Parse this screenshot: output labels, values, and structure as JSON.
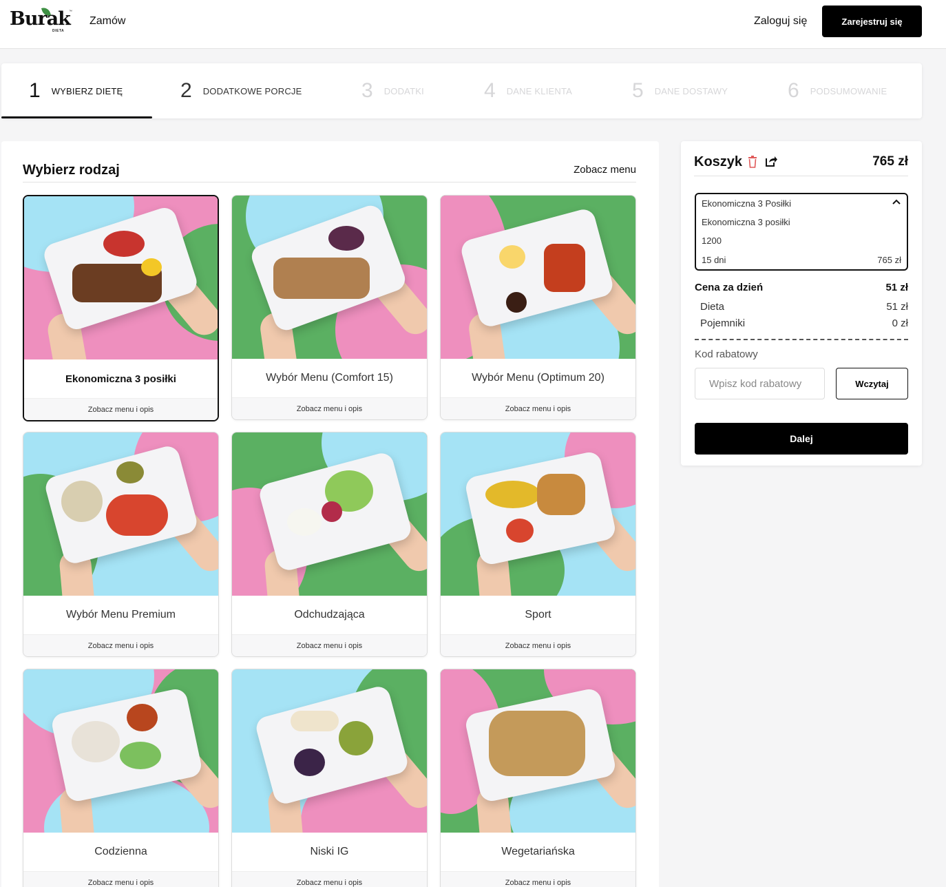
{
  "header": {
    "logo_text": "Burak",
    "logo_sub": "DIETA",
    "logo_tm": "™",
    "nav_order": "Zamów",
    "login": "Zaloguj się",
    "register": "Zarejestruj się"
  },
  "steps": [
    {
      "num": "1",
      "label": "WYBIERZ DIETĘ",
      "state": "active"
    },
    {
      "num": "2",
      "label": "DODATKOWE PORCJE",
      "state": "done"
    },
    {
      "num": "3",
      "label": "DODATKI",
      "state": "disabled"
    },
    {
      "num": "4",
      "label": "DANE KLIENTA",
      "state": "disabled"
    },
    {
      "num": "5",
      "label": "DANE DOSTAWY",
      "state": "disabled"
    },
    {
      "num": "6",
      "label": "PODSUMOWANIE",
      "state": "disabled"
    }
  ],
  "main": {
    "title": "Wybierz rodzaj",
    "see_menu": "Zobacz menu"
  },
  "diets": [
    {
      "name": "Ekonomiczna 3 posiłki",
      "link": "Zobacz menu i opis",
      "selected": true
    },
    {
      "name": "Wybór Menu (Comfort 15)",
      "link": "Zobacz menu i opis",
      "selected": false
    },
    {
      "name": "Wybór Menu (Optimum 20)",
      "link": "Zobacz menu i opis",
      "selected": false
    },
    {
      "name": "Wybór Menu Premium",
      "link": "Zobacz menu i opis",
      "selected": false
    },
    {
      "name": "Odchudzająca",
      "link": "Zobacz menu i opis",
      "selected": false
    },
    {
      "name": "Sport",
      "link": "Zobacz menu i opis",
      "selected": false
    },
    {
      "name": "Codzienna",
      "link": "Zobacz menu i opis",
      "selected": false
    },
    {
      "name": "Niski IG",
      "link": "Zobacz menu i opis",
      "selected": false
    },
    {
      "name": "Wegetariańska",
      "link": "Zobacz menu i opis",
      "selected": false
    }
  ],
  "cart": {
    "title": "Koszyk",
    "total": "765 zł",
    "item": {
      "line1": "Ekonomiczna 3 Posiłki",
      "line2": "Ekonomiczna 3 posiłki",
      "line3": "1200",
      "line4": "15 dni",
      "price": "765 zł"
    },
    "price_per_day_label": "Cena za dzień",
    "price_per_day": "51 zł",
    "diet_label": "Dieta",
    "diet_value": "51 zł",
    "containers_label": "Pojemniki",
    "containers_value": "0 zł",
    "promo_label": "Kod rabatowy",
    "promo_placeholder": "Wpisz kod rabatowy",
    "promo_button": "Wczytaj",
    "next_button": "Dalej"
  },
  "colors": {
    "pink": "#ee8fbe",
    "green": "#5bb062",
    "blue": "#a5e3f5",
    "trash": "#e05a5a"
  }
}
